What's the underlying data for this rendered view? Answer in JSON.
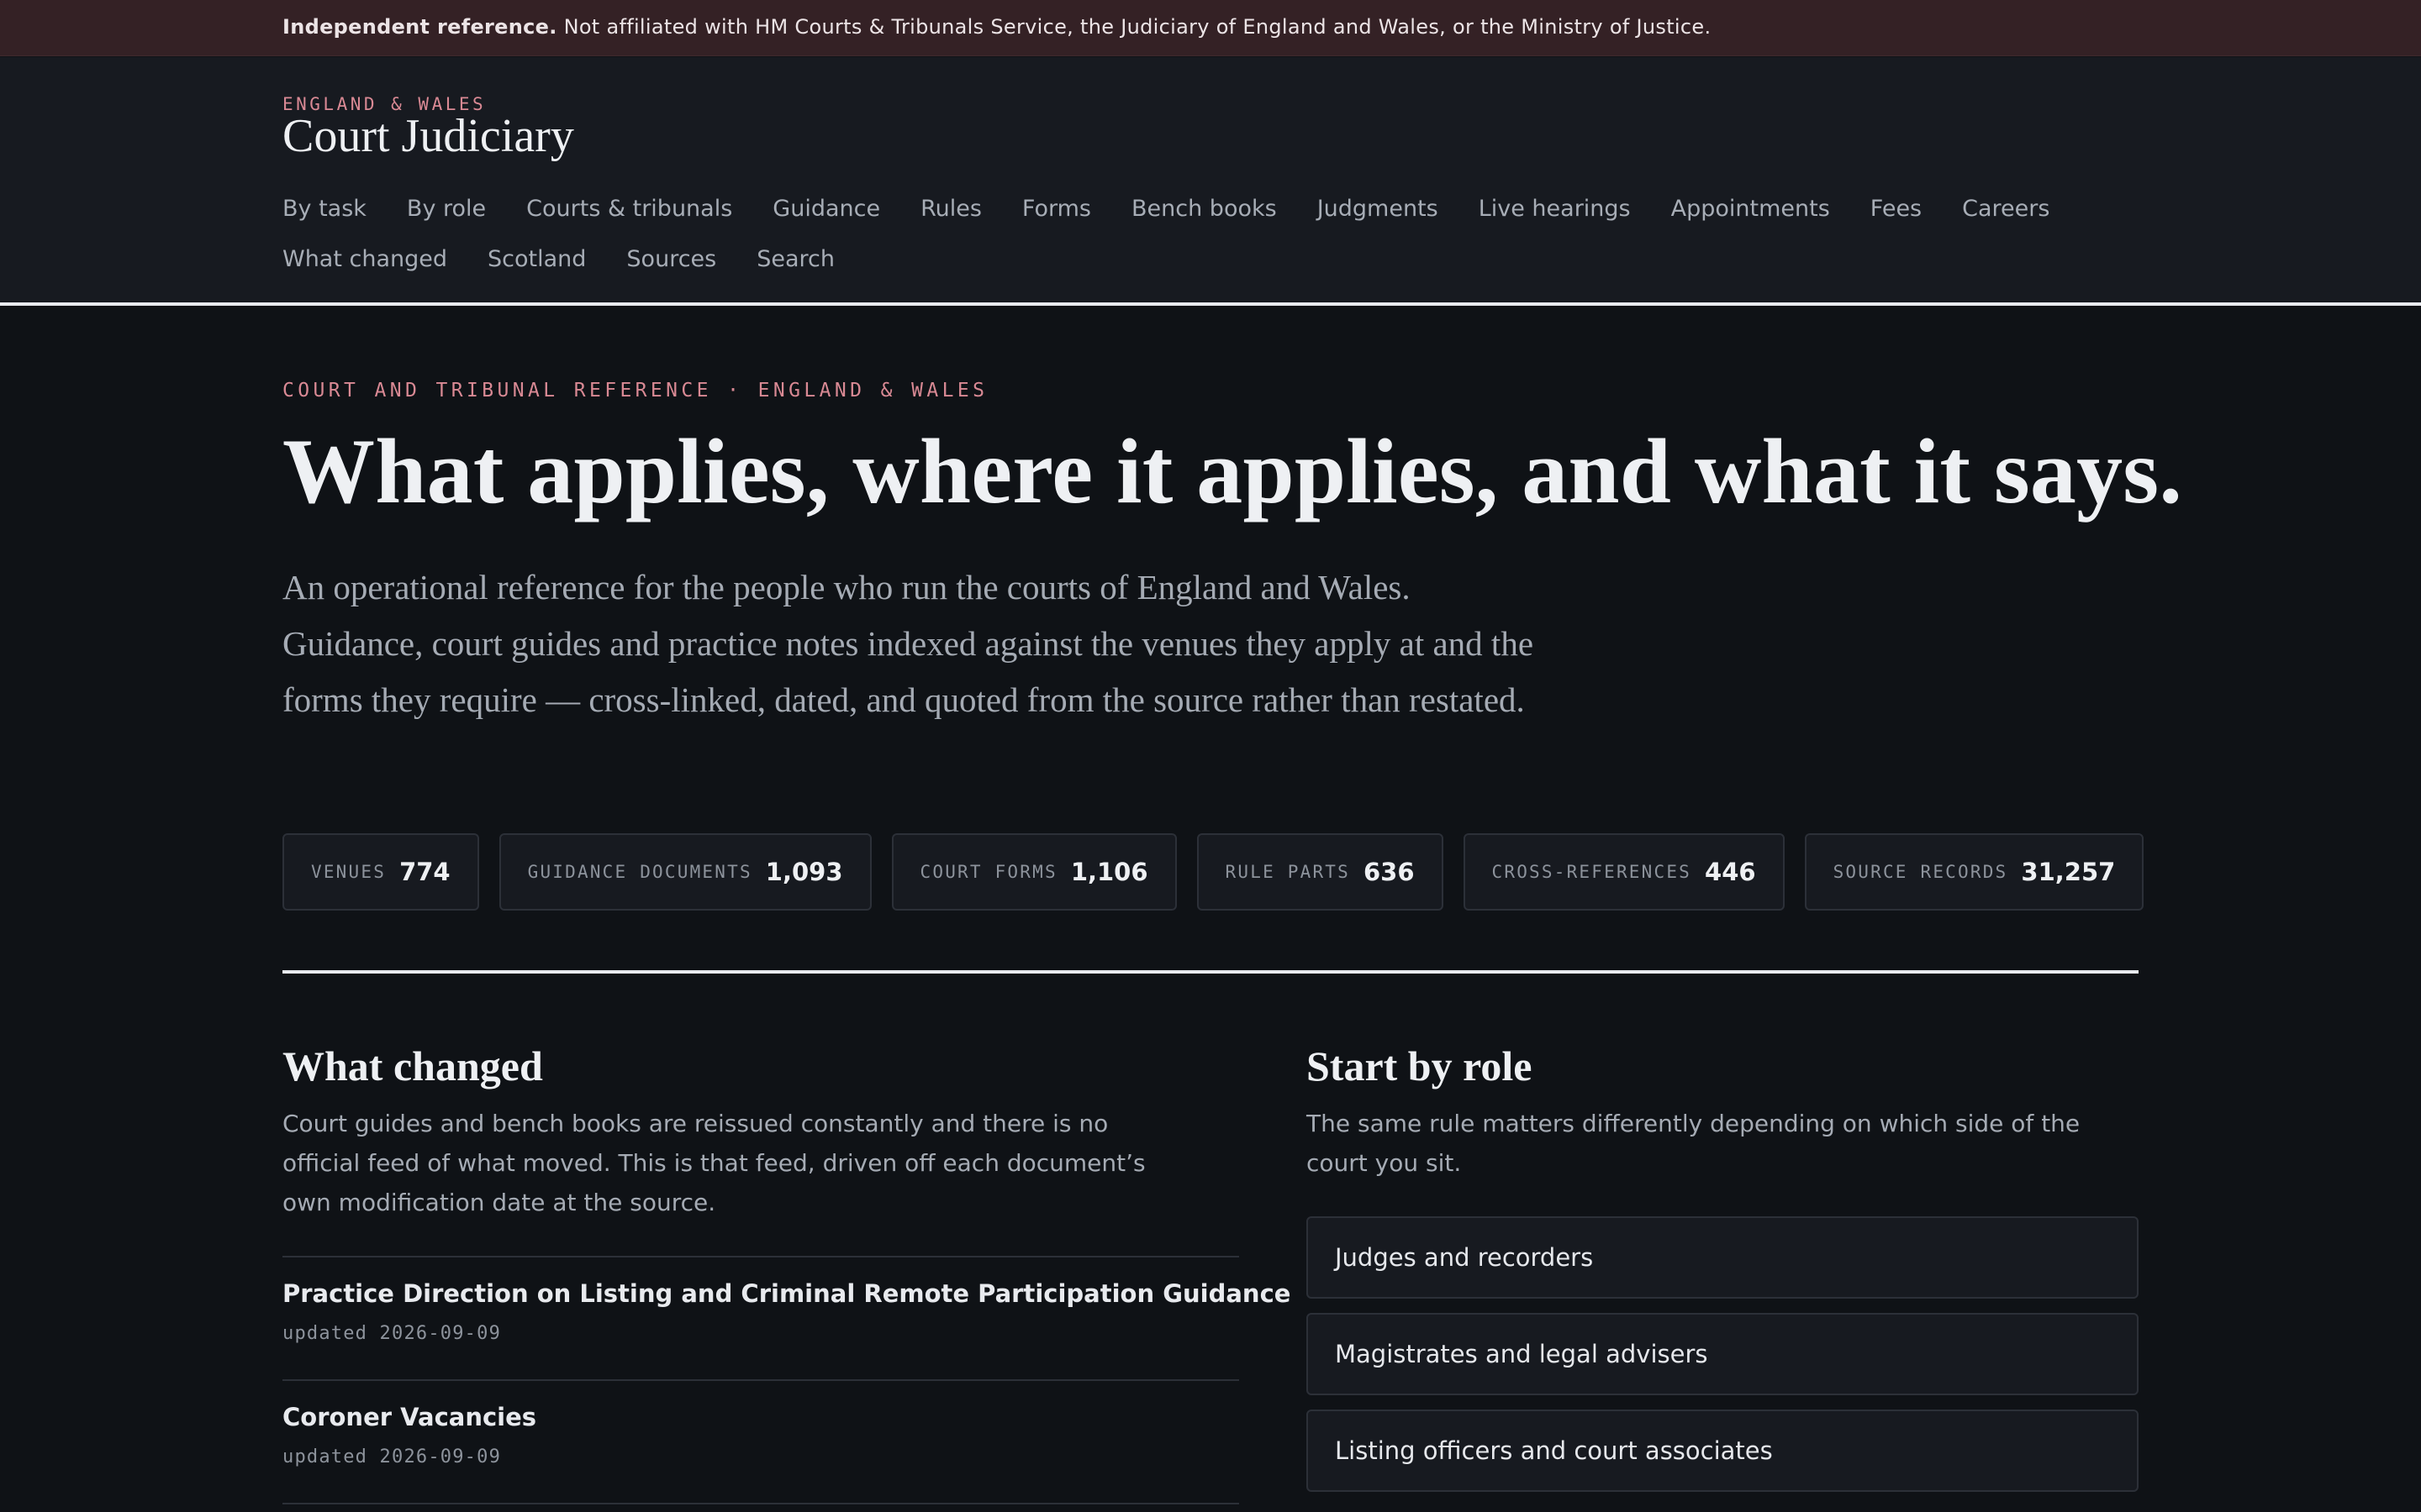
{
  "banner": {
    "bold": "Independent reference.",
    "text": " Not affiliated with HM Courts & Tribunals Service, the Judiciary of England and Wales, or the Ministry of Justice."
  },
  "header": {
    "kicker": "ENGLAND & WALES",
    "brand": "Court Judiciary",
    "nav_row1": [
      "By task",
      "By role",
      "Courts & tribunals",
      "Guidance",
      "Rules",
      "Forms",
      "Bench books",
      "Judgments",
      "Live hearings",
      "Appointments",
      "Fees",
      "Careers"
    ],
    "nav_row2": [
      "What changed",
      "Scotland",
      "Sources",
      "Search"
    ]
  },
  "hero": {
    "eyebrow": "COURT AND TRIBUNAL REFERENCE · ENGLAND & WALES",
    "title": "What applies, where it applies, and what it says.",
    "lead": "An operational reference for the people who run the courts of England and Wales. Guidance, court guides and practice notes indexed against the venues they apply at and the forms they require — cross-linked, dated, and quoted from the source rather than restated."
  },
  "stats": [
    {
      "label": "VENUES",
      "value": "774"
    },
    {
      "label": "GUIDANCE DOCUMENTS",
      "value": "1,093"
    },
    {
      "label": "COURT FORMS",
      "value": "1,106"
    },
    {
      "label": "RULE PARTS",
      "value": "636"
    },
    {
      "label": "CROSS-REFERENCES",
      "value": "446"
    },
    {
      "label": "SOURCE RECORDS",
      "value": "31,257"
    }
  ],
  "what_changed": {
    "title": "What changed",
    "desc": "Court guides and bench books are reissued constantly and there is no official feed of what moved. This is that feed, driven off each document’s own modification date at the source.",
    "items": [
      {
        "title": "Practice Direction on Listing and Criminal Remote Participation Guidance",
        "date": "updated 2026-09-09"
      },
      {
        "title": "Coroner Vacancies",
        "date": "updated 2026-09-09"
      }
    ]
  },
  "start_by_role": {
    "title": "Start by role",
    "desc": "The same rule matters differently depending on which side of the court you sit.",
    "roles": [
      "Judges and recorders",
      "Magistrates and legal advisers",
      "Listing officers and court associates"
    ]
  }
}
